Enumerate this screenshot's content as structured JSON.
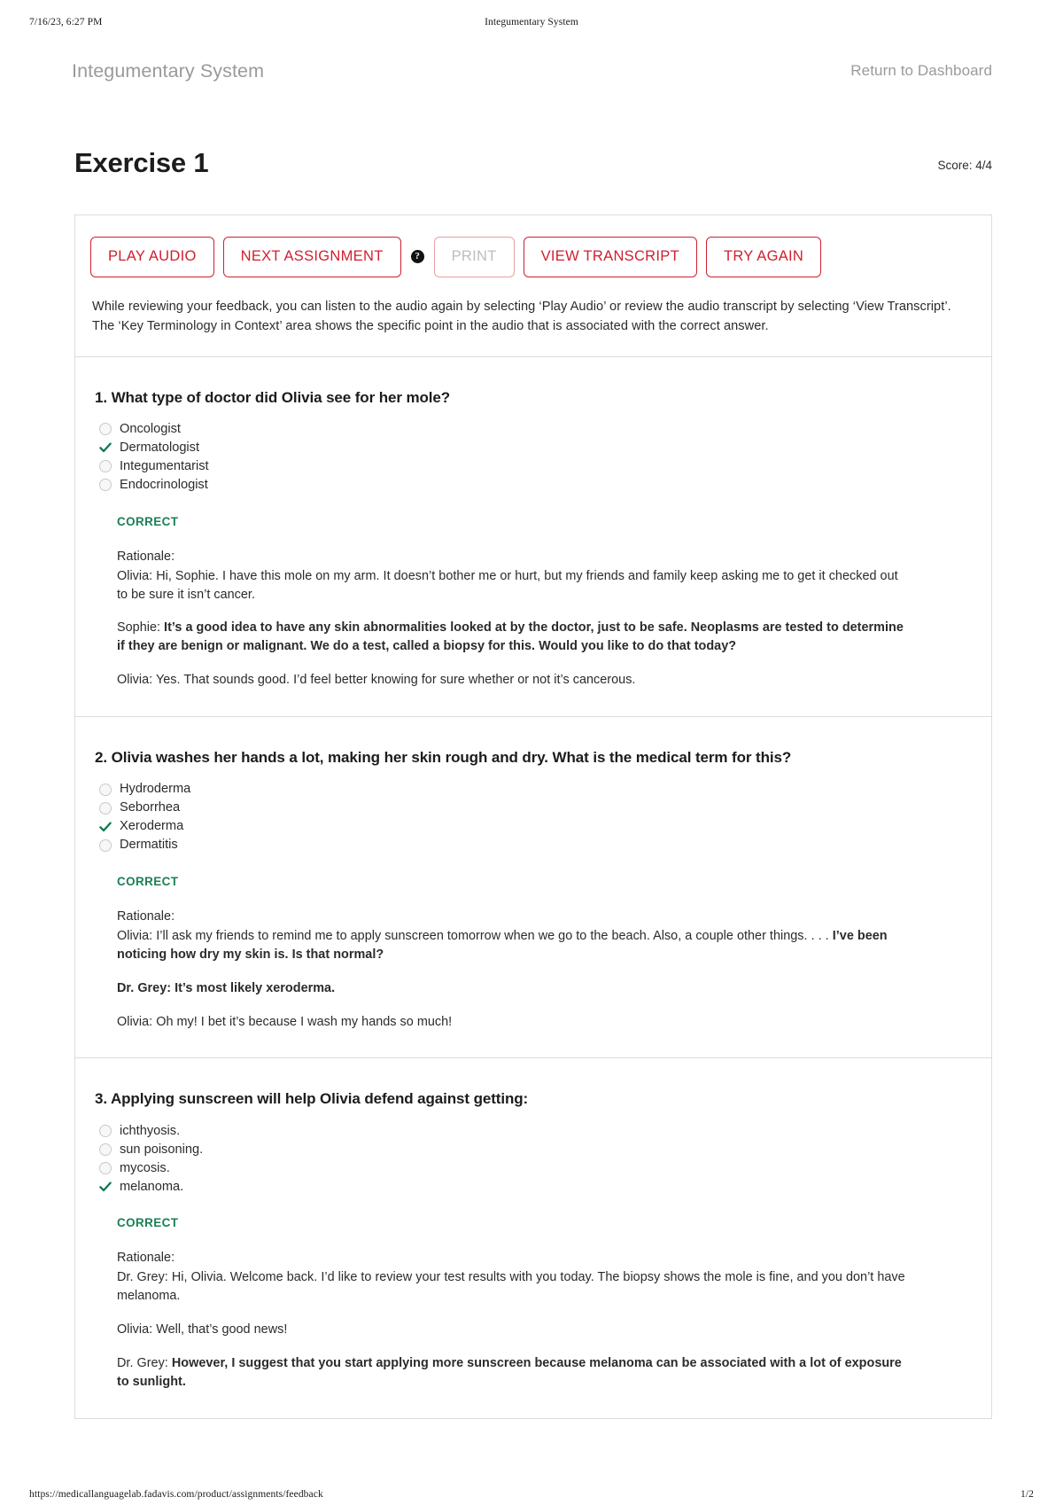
{
  "print": {
    "datetime": "7/16/23, 6:27 PM",
    "doc_title": "Integumentary System",
    "url": "https://medicallanguagelab.fadavis.com/product/assignments/feedback",
    "page_indicator": "1/2"
  },
  "header": {
    "site_title": "Integumentary System",
    "return_link": "Return to Dashboard"
  },
  "title_row": {
    "exercise_title": "Exercise 1",
    "score": "Score: 4/4"
  },
  "toolbar": {
    "play_audio": "PLAY AUDIO",
    "next_assignment": "NEXT ASSIGNMENT",
    "help_glyph": "?",
    "print": "PRINT",
    "view_transcript": "VIEW TRANSCRIPT",
    "try_again": "TRY AGAIN",
    "note": "While reviewing your feedback, you can listen to the audio again by selecting ‘Play Audio’ or review the audio transcript by selecting ‘View Transcript’. The ‘Key Terminology in Context’ area shows the specific point in the audio that is associated with the correct answer."
  },
  "colors": {
    "accent_red": "#d0202f",
    "correct_green": "#1a8055",
    "check_green": "#0f7a4e",
    "muted_gray": "#9a9a9a"
  },
  "questions": [
    {
      "number": "1.",
      "text": "1. What type of doctor did Olivia see for her mole?",
      "options": [
        {
          "label": "Oncologist",
          "selected": false
        },
        {
          "label": "Dermatologist",
          "selected": true
        },
        {
          "label": "Integumentarist",
          "selected": false
        },
        {
          "label": "Endocrinologist",
          "selected": false
        }
      ],
      "verdict": "CORRECT",
      "rationale_label": "Rationale:",
      "rationale": [
        {
          "plain": "Olivia: Hi, Sophie. I have this mole on my arm. It doesn’t bother me or hurt, but my friends and family keep asking me to get it checked out to be sure it isn’t cancer.",
          "bold": ""
        },
        {
          "plain": "Sophie: ",
          "bold": "It’s a good idea to have any skin abnormalities looked at by the doctor, just to be safe. Neoplasms are tested to determine if they are benign or malignant. We do a test, called a biopsy for this. Would you like to do that today?"
        },
        {
          "plain": "Olivia: Yes. That sounds good. I’d feel better knowing for sure whether or not it’s cancerous.",
          "bold": ""
        }
      ]
    },
    {
      "number": "2.",
      "text": "2. Olivia washes her hands a lot, making her skin rough and dry. What is the medical term for this?",
      "options": [
        {
          "label": "Hydroderma",
          "selected": false
        },
        {
          "label": "Seborrhea",
          "selected": false
        },
        {
          "label": "Xeroderma",
          "selected": true
        },
        {
          "label": "Dermatitis",
          "selected": false
        }
      ],
      "verdict": "CORRECT",
      "rationale_label": "Rationale:",
      "rationale": [
        {
          "plain": "Olivia: I’ll ask my friends to remind me to apply sunscreen tomorrow when we go to the beach. Also, a couple other things. . . . ",
          "bold": "I’ve been noticing how dry my skin is. Is that normal?"
        },
        {
          "plain": "",
          "bold": "Dr. Grey: It’s most likely xeroderma."
        },
        {
          "plain": "Olivia: Oh my! I bet it’s because I wash my hands so much!",
          "bold": ""
        }
      ]
    },
    {
      "number": "3.",
      "text": "3. Applying sunscreen will help Olivia defend against getting:",
      "options": [
        {
          "label": "ichthyosis.",
          "selected": false
        },
        {
          "label": "sun poisoning.",
          "selected": false
        },
        {
          "label": "mycosis.",
          "selected": false
        },
        {
          "label": "melanoma.",
          "selected": true
        }
      ],
      "verdict": "CORRECT",
      "rationale_label": "Rationale:",
      "rationale": [
        {
          "plain": "Dr. Grey: Hi, Olivia. Welcome back. I’d like to review your test results with you today. The biopsy shows the mole is fine, and you don’t have melanoma.",
          "bold": ""
        },
        {
          "plain": "Olivia: Well, that’s good news!",
          "bold": ""
        },
        {
          "plain": "Dr. Grey: ",
          "bold": "However, I suggest that you start applying more sunscreen because melanoma can be associated with a lot of exposure to sunlight."
        }
      ]
    }
  ]
}
